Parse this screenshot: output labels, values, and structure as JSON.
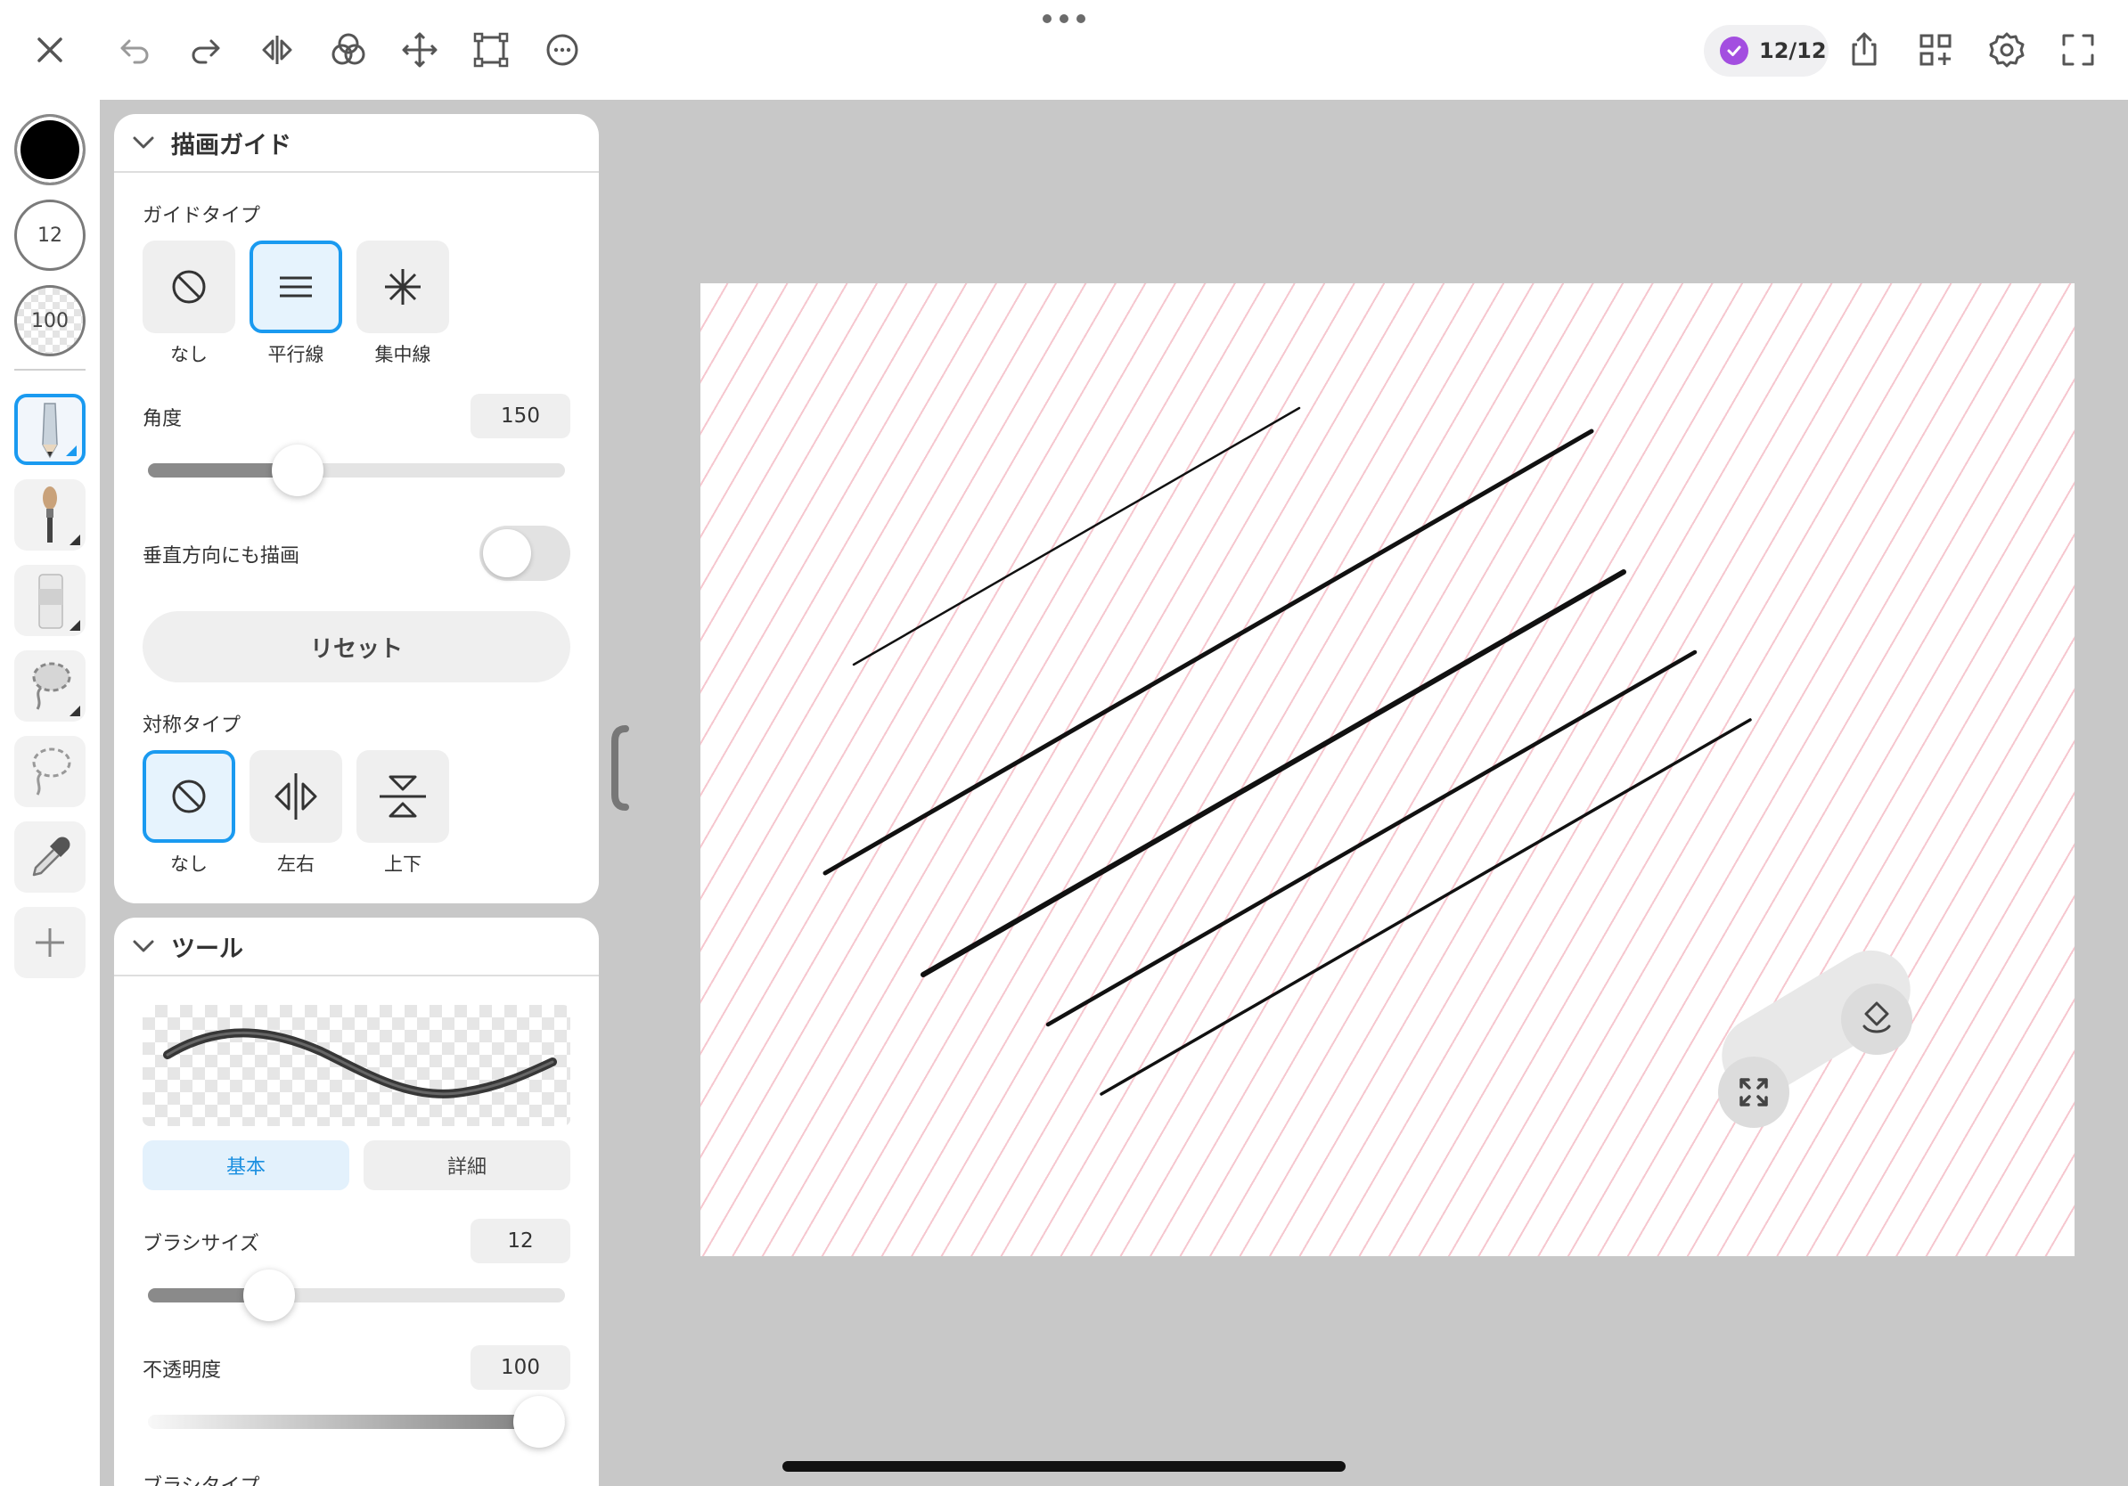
{
  "toolbar": {
    "counter": "12/12",
    "accent_color": "#a34ee0"
  },
  "rail": {
    "brush_size": "12",
    "opacity": "100",
    "color": "#000000",
    "selected_tool_color": "#1a9af0"
  },
  "guide_panel": {
    "title": "描画ガイド",
    "guide_type_label": "ガイドタイプ",
    "guide_types": [
      {
        "label": "なし",
        "icon": "prohibit-icon"
      },
      {
        "label": "平行線",
        "icon": "parallel-lines-icon"
      },
      {
        "label": "集中線",
        "icon": "radial-lines-icon"
      }
    ],
    "selected_guide": "平行線",
    "angle_label": "角度",
    "angle_value": "150",
    "angle_fraction": 0.36,
    "vertical_label": "垂直方向にも描画",
    "vertical_on": false,
    "reset_label": "リセット",
    "symmetry_label": "対称タイプ",
    "symmetry_types": [
      {
        "label": "なし",
        "icon": "prohibit-icon"
      },
      {
        "label": "左右",
        "icon": "mirror-horizontal-icon"
      },
      {
        "label": "上下",
        "icon": "mirror-vertical-icon"
      }
    ],
    "selected_symmetry": "なし"
  },
  "tool_panel": {
    "title": "ツール",
    "tab_basic": "基本",
    "tab_detail": "詳細",
    "brush_size_label": "ブラシサイズ",
    "brush_size_value": "12",
    "brush_size_fraction": 0.29,
    "opacity_label": "不透明度",
    "opacity_value": "100",
    "opacity_fraction": 1.0,
    "brush_type_label": "ブラシタイプ"
  }
}
